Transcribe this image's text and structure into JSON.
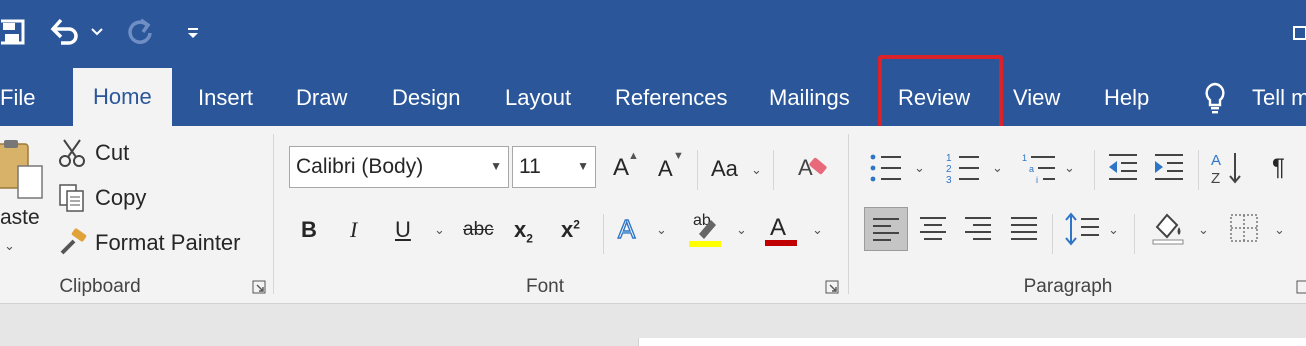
{
  "qat": {
    "save_icon": "save-icon",
    "undo_icon": "undo-icon",
    "redo_icon": "redo-icon",
    "customize_icon": "customize-qat-icon"
  },
  "tabs": [
    {
      "label": "File"
    },
    {
      "label": "Home",
      "active": true
    },
    {
      "label": "Insert"
    },
    {
      "label": "Draw"
    },
    {
      "label": "Design"
    },
    {
      "label": "Layout"
    },
    {
      "label": "References"
    },
    {
      "label": "Mailings"
    },
    {
      "label": "Review",
      "highlighted": true
    },
    {
      "label": "View"
    },
    {
      "label": "Help"
    },
    {
      "label": "Tell m"
    }
  ],
  "clipboard": {
    "paste_label": "aste",
    "cut_label": "Cut",
    "copy_label": "Copy",
    "format_painter_label": "Format Painter",
    "group_label": "Clipboard"
  },
  "font": {
    "font_name": "Calibri (Body)",
    "font_size": "11",
    "grow_label": "A",
    "shrink_label": "A",
    "change_case_label": "Aa",
    "bold_label": "B",
    "italic_label": "I",
    "underline_label": "U",
    "strike_label": "abc",
    "subscript_label": "x",
    "subscript_sub": "2",
    "superscript_label": "x",
    "superscript_sup": "2",
    "text_effects_label": "A",
    "highlight_label": "ab",
    "font_color_label": "A",
    "group_label": "Font"
  },
  "paragraph": {
    "group_label": "Paragraph",
    "pilcrow": "¶"
  },
  "colors": {
    "ribbon_blue": "#2b579a",
    "highlight_red": "#d9222a",
    "highlight_yellow": "#ffff00",
    "font_color_red": "#c00000"
  }
}
